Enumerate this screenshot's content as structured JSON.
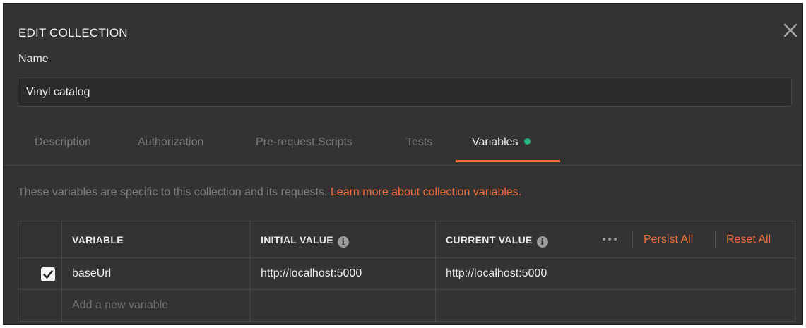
{
  "modal": {
    "title": "EDIT COLLECTION",
    "close_icon": "close-icon"
  },
  "name_field": {
    "label": "Name",
    "value": "Vinyl catalog"
  },
  "tabs": [
    {
      "label": "Description",
      "active": false
    },
    {
      "label": "Authorization",
      "active": false
    },
    {
      "label": "Pre-request Scripts",
      "active": false
    },
    {
      "label": "Tests",
      "active": false
    },
    {
      "label": "Variables",
      "active": true,
      "indicator_color": "#26b47f"
    }
  ],
  "info": {
    "text": "These variables are specific to this collection and its requests.",
    "link": "Learn more about collection variables."
  },
  "table": {
    "headers": {
      "variable": "VARIABLE",
      "initial_value": "INITIAL VALUE",
      "current_value": "CURRENT VALUE",
      "info_icon": "info-icon"
    },
    "actions": {
      "more_icon": "more-horizontal-icon",
      "persist_all": "Persist All",
      "reset_all": "Reset All"
    },
    "rows": [
      {
        "enabled": true,
        "variable": "baseUrl",
        "initial_value": "http://localhost:5000",
        "current_value": "http://localhost:5000"
      }
    ],
    "new_row_placeholder": "Add a new variable"
  },
  "colors": {
    "background": "#333333",
    "accent": "#f26b3a",
    "active_dot": "#26b47f",
    "border": "#474747"
  }
}
